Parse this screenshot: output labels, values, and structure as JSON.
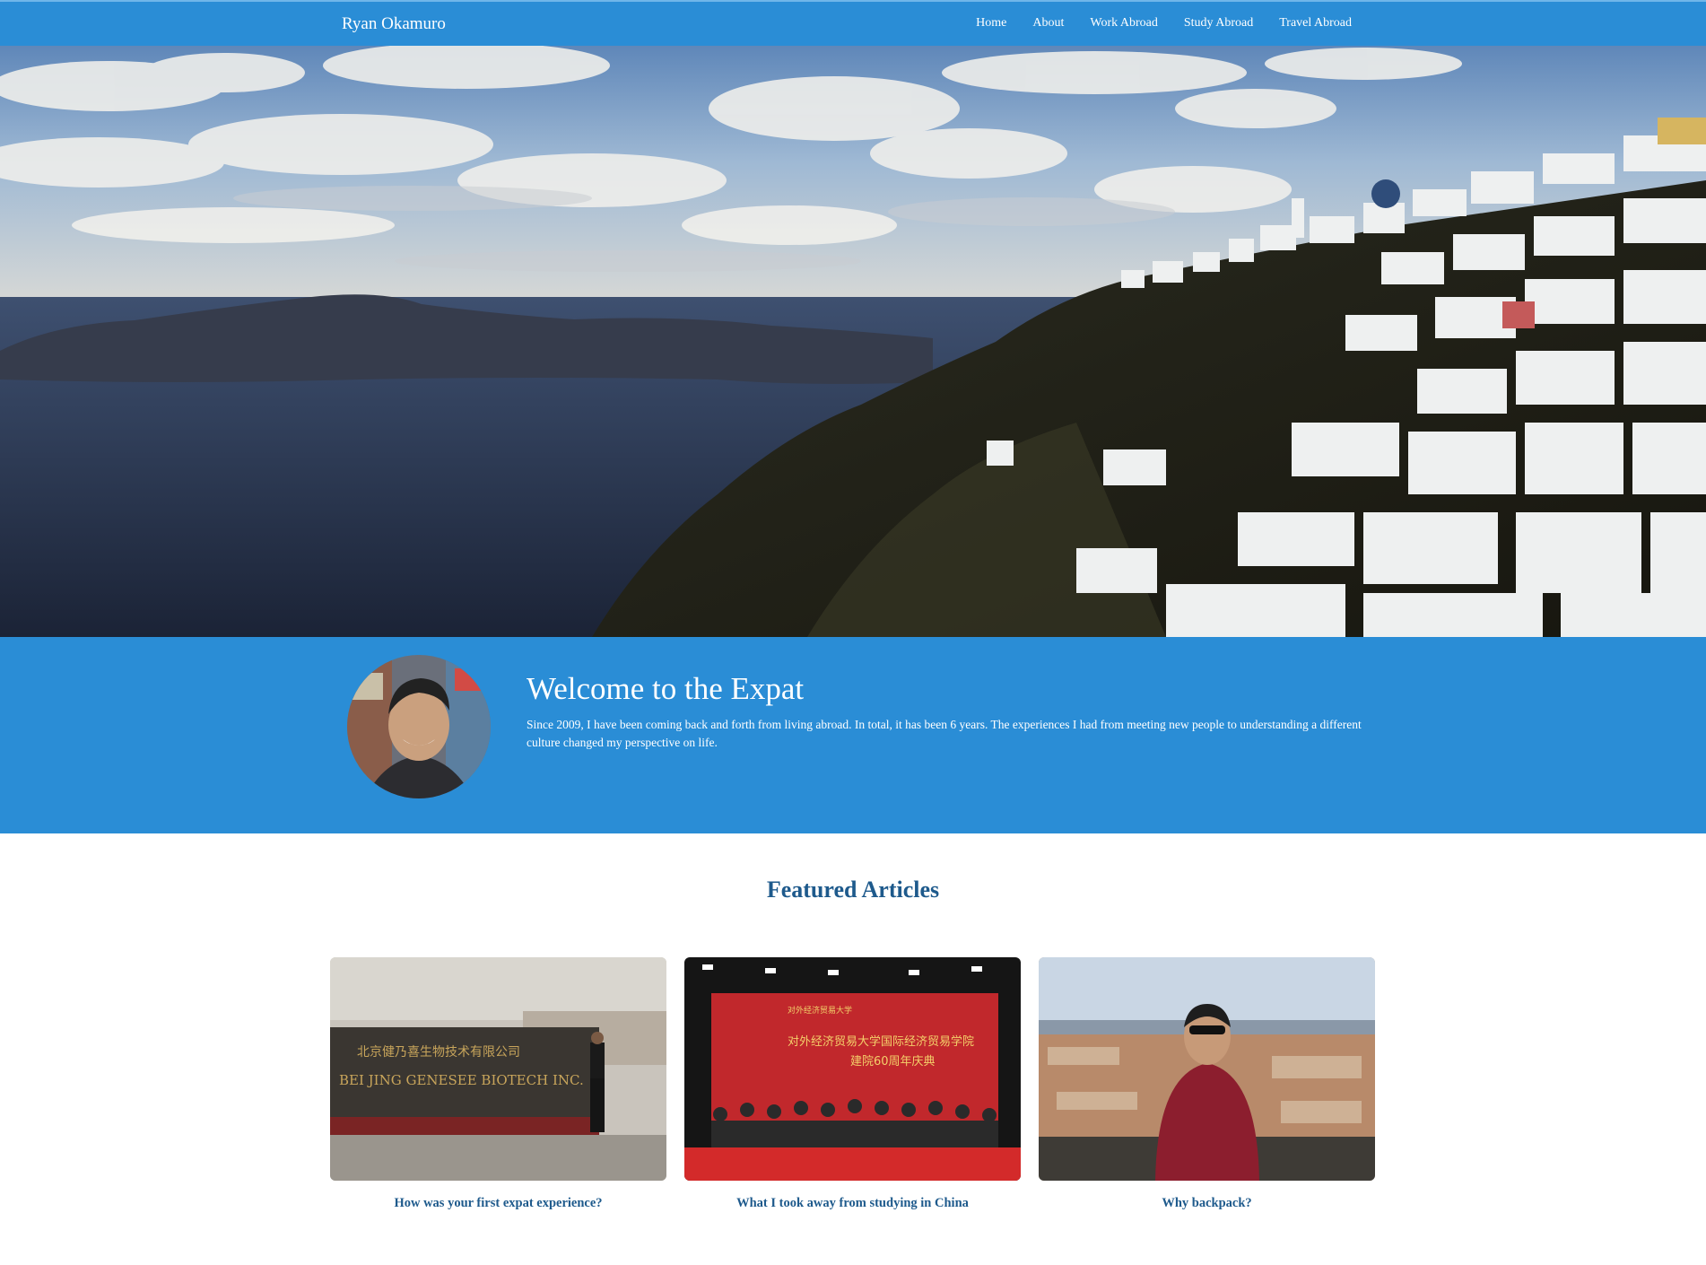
{
  "nav": {
    "brand": "Ryan Okamuro",
    "links": [
      "Home",
      "About",
      "Work Abroad",
      "Study Abroad",
      "Travel Abroad"
    ]
  },
  "hero": {
    "image": "santorini-caldera-photo"
  },
  "welcome": {
    "title": "Welcome to the Expat",
    "text": "Since 2009, I have been coming back and forth from living abroad. In total, it has been 6 years. The experiences I had from meeting new people to understanding a different culture changed my perspective on life.",
    "avatar": "profile-photo"
  },
  "featured": {
    "title": "Featured Articles",
    "articles": [
      {
        "caption": "How was your first expat experience?",
        "image": "biotech-sign-photo",
        "sign_cn": "北京健乃喜生物技术有限公司",
        "sign_en": "BEI JING GENESEE BIOTECH INC."
      },
      {
        "caption": "What I took away from studying in China",
        "image": "university-ceremony-photo",
        "banner_line1": "对外经济贸易大学国际经济贸易学院",
        "banner_line2": "建院60周年庆典"
      },
      {
        "caption": "Why backpack?",
        "image": "city-overlook-photo"
      }
    ]
  },
  "colors": {
    "primary": "#2a8dd6",
    "heading": "#1e5a8c",
    "white": "#ffffff"
  }
}
